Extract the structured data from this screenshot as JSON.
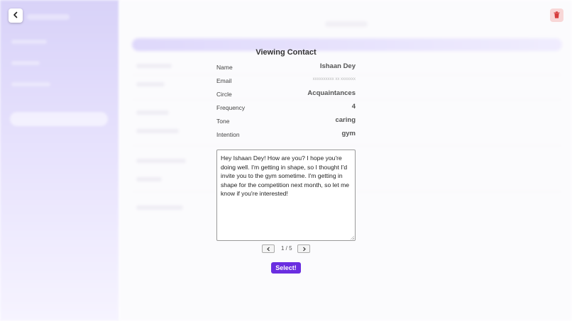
{
  "modal": {
    "title": "Viewing Contact",
    "fields": [
      {
        "label": "Name",
        "value": "Ishaan Dey"
      },
      {
        "label": "Email",
        "value": "xxxxxxxxxx xx xxxxxxx"
      },
      {
        "label": "Circle",
        "value": "Acquaintances"
      },
      {
        "label": "Frequency",
        "value": "4"
      },
      {
        "label": "Tone",
        "value": "caring"
      },
      {
        "label": "Intention",
        "value": "gym"
      }
    ],
    "message": "Hey Ishaan Dey! How are you? I hope you're doing well. I'm getting in shape, so I thought I'd invite you to the gym sometime. I'm getting in shape for the competition next month, so let me know if you're interested!",
    "pager": {
      "count": "1 / 5"
    },
    "select_label": "Select!"
  },
  "icons": {
    "back": "chevron-left-icon",
    "delete": "trash-icon",
    "prev": "chevron-left-icon",
    "next": "chevron-right-icon"
  },
  "colors": {
    "accent": "#6a2ee0",
    "delete_bg": "#f8d7d7",
    "delete_icon": "#d63b3b",
    "sidebar_top": "#a99cf0"
  }
}
